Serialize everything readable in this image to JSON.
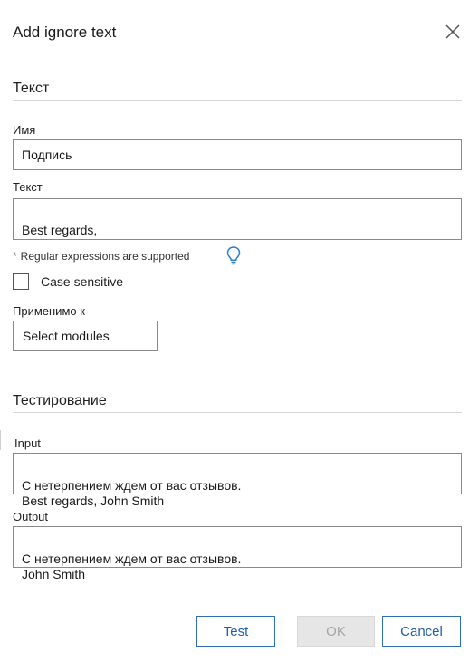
{
  "dialog": {
    "title": "Add ignore text",
    "close_icon": "close-icon"
  },
  "text_section": {
    "title": "Текст",
    "name_label": "Имя",
    "name_value": "Подпись",
    "text_label": "Текст",
    "text_value": "Best regards,",
    "hint_star": "*",
    "hint": "Regular expressions are supported",
    "hint_icon": "lightbulb-icon",
    "case_sensitive_label": "Case sensitive",
    "case_sensitive_checked": false,
    "applicable_label": "Применимо к",
    "applicable_value": "Select modules"
  },
  "testing_section": {
    "title": "Тестирование",
    "input_label": "Input",
    "input_value": "С нетерпением ждем от вас отзывов.\nBest regards, John Smith",
    "output_label": "Output",
    "output_value": "С нетерпением ждем от вас отзывов.\nJohn Smith"
  },
  "buttons": {
    "test": "Test",
    "ok": "OK",
    "cancel": "Cancel"
  },
  "colors": {
    "accent": "#2e6fb5",
    "disabled_bg": "#e6e6e6",
    "disabled_text": "#a6a6a6",
    "border": "#8a8a8a"
  }
}
